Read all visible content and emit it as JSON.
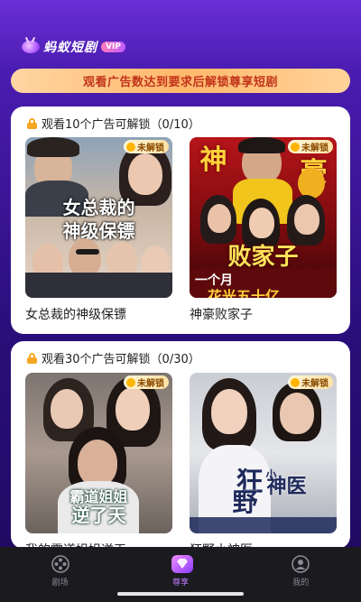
{
  "app": {
    "name": "蚂蚁短剧",
    "vip_label": "VIP"
  },
  "banner": {
    "text": "观看广告数达到要求后解锁尊享短剧"
  },
  "sections": [
    {
      "title": "观看10个广告可解锁（0/10）",
      "items": [
        {
          "title": "女总裁的神级保镖",
          "badge": "未解锁",
          "poster_text": [
            "女总裁的",
            "神级保镖"
          ]
        },
        {
          "title": "神豪败家子",
          "badge": "未解锁",
          "poster_text": [
            "神",
            "豪",
            "败家子",
            "一个月",
            "花光五十亿"
          ]
        }
      ]
    },
    {
      "title": "观看30个广告可解锁（0/30）",
      "items": [
        {
          "title": "我的霸道姐姐逆天",
          "badge": "未解锁",
          "poster_text": [
            "霸道姐姐",
            "逆了天"
          ]
        },
        {
          "title": "狂野小神医",
          "badge": "未解锁",
          "poster_text": [
            "狂",
            "小",
            "野",
            "神医"
          ]
        }
      ]
    }
  ],
  "tabbar": {
    "items": [
      {
        "label": "剧场",
        "icon": "film-reel-icon",
        "active": false
      },
      {
        "label": "尊享",
        "icon": "diamond-icon",
        "active": true
      },
      {
        "label": "我的",
        "icon": "user-icon",
        "active": false
      }
    ]
  },
  "colors": {
    "accent": "#c07cff",
    "banner_text": "#c2341b",
    "badge_text": "#8a4b00"
  }
}
